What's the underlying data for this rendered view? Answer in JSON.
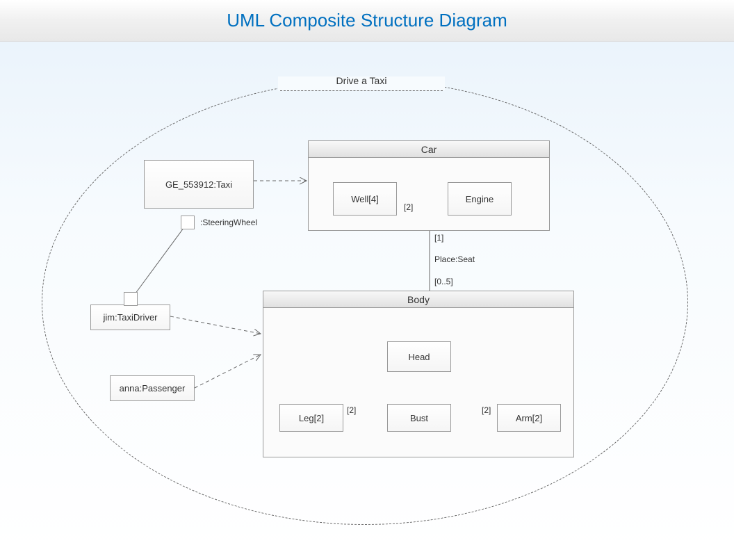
{
  "header": {
    "title": "UML Composite Structure Diagram"
  },
  "collaboration": {
    "label": "Drive a Taxi"
  },
  "taxi": {
    "label": "GE_553912:Taxi"
  },
  "driver": {
    "label": "jim:TaxiDriver"
  },
  "passenger": {
    "label": "anna:Passenger"
  },
  "steering": {
    "label": ":SteeringWheel"
  },
  "car": {
    "title": "Car",
    "well": "Well[4]",
    "wellMult": "[2]",
    "engine": "Engine"
  },
  "body": {
    "title": "Body",
    "head": "Head",
    "leg": "Leg[2]",
    "legMult": "[2]",
    "bust": "Bust",
    "arm": "Arm[2]",
    "armMult": "[2]"
  },
  "seat": {
    "topMult": "[1]",
    "label": "Place:Seat",
    "bottomMult": "[0..5]"
  }
}
